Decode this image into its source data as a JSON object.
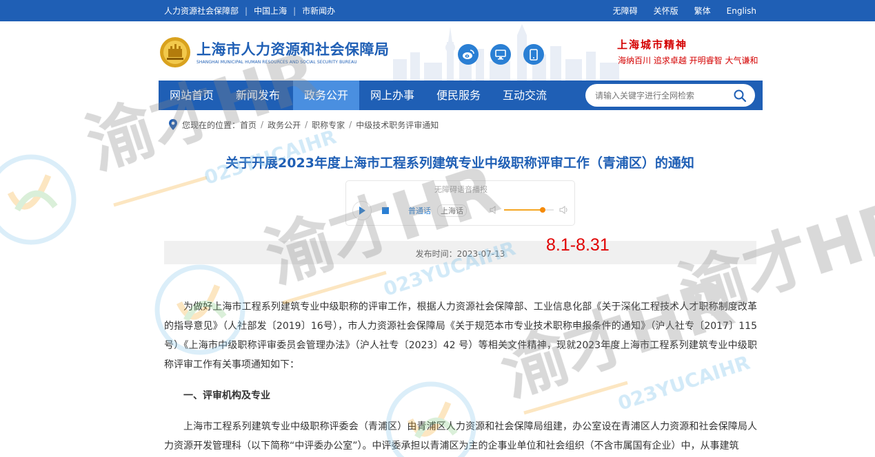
{
  "topbar": {
    "links": [
      "人力资源社会保障部",
      "中国上海",
      "市新闻办"
    ],
    "right": [
      "无障碍",
      "关怀版",
      "繁体",
      "English"
    ]
  },
  "header": {
    "org_cn": "上海市人力资源和社会保障局",
    "org_en": "SHANGHAI MUNICIPAL HUMAN RESOURCES AND SOCIAL SECURITY BUREAU",
    "social_icons": [
      "weibo-icon",
      "monitor-icon",
      "mobile-icon"
    ],
    "spirit_title": "上海城市精神",
    "spirit_words": "海纳百川  追求卓越  开明睿智  大气谦和"
  },
  "nav": {
    "items": [
      "网站首页",
      "新闻发布",
      "政务公开",
      "网上办事",
      "便民服务",
      "互动交流"
    ],
    "active_index": 2,
    "search_placeholder": "请输入关键字进行全网检索"
  },
  "breadcrumb": {
    "label": "您现在的位置：",
    "items": [
      "首页",
      "政务公开",
      "职称专家",
      "中级技术职务评审通知"
    ]
  },
  "article": {
    "title": "关于开展2023年度上海市工程系列建筑专业中级职称评审工作（青浦区）的通知",
    "publish": "发布时间：2023-07-13",
    "paragraph1": "为做好上海市工程系列建筑专业中级职称的评审工作，根据人力资源社会保障部、工业信息化部《关于深化工程技术人才职称制度改革的指导意见》（人社部发〔2019〕16号），市人力资源社会保障局《关于规范本市专业技术职称申报条件的通知》（沪人社专〔2017〕115号）《上海市中级职称评审委员会管理办法》（沪人社专〔2023〕42 号）等相关文件精神，现就2023年度上海市工程系列建筑专业中级职称评审工作有关事项通知如下：",
    "section1": "一、评审机构及专业",
    "paragraph2": "上海市工程系列建筑专业中级职称评委会（青浦区）由青浦区人力资源和社会保障局组建，办公室设在青浦区人力资源和社会保障局人力资源开发管理科（以下简称“中评委办公室”）。中评委承担以青浦区为主的企事业单位和社会组织（不含市属国有企业）中，从事建筑"
  },
  "player": {
    "title": "无障碍语音播报",
    "lang_mandarin": "普通话",
    "lang_shanghai": "上海话",
    "volume": 0.78
  },
  "annotation": {
    "date_range": "8.1-8.31"
  },
  "watermark": {
    "brand_cn": "渝才HR",
    "brand_en": "023YUCAIHR"
  },
  "colors": {
    "primary": "#1f5fb5",
    "nav_active": "#4a8fe0",
    "accent_red": "#d40000",
    "player_blue": "#2a7fd4",
    "slider": "#f58a07"
  }
}
